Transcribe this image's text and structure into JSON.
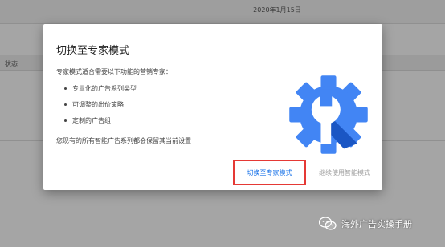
{
  "background": {
    "date": "2020年1月15日",
    "status_header": "状态"
  },
  "dialog": {
    "title": "切换至专家模式",
    "intro": "专家模式适合需要以下功能的营销专家：",
    "bullets": [
      "专业化的广告系列类型",
      "可调整的出价策略",
      "定制的广告组"
    ],
    "note": "您现有的所有智能广告系列都会保留其当前设置",
    "switch_label": "切换至专家模式",
    "keep_label": "继续使用智能模式",
    "icon": "gear-wrench-icon",
    "colors": {
      "icon_blue": "#4285f4",
      "icon_dark": "#1a56c4",
      "link": "#1a73e8",
      "highlight": "#e53935"
    }
  },
  "watermark": {
    "text": "海外广告实操手册",
    "icon": "wechat-icon"
  }
}
